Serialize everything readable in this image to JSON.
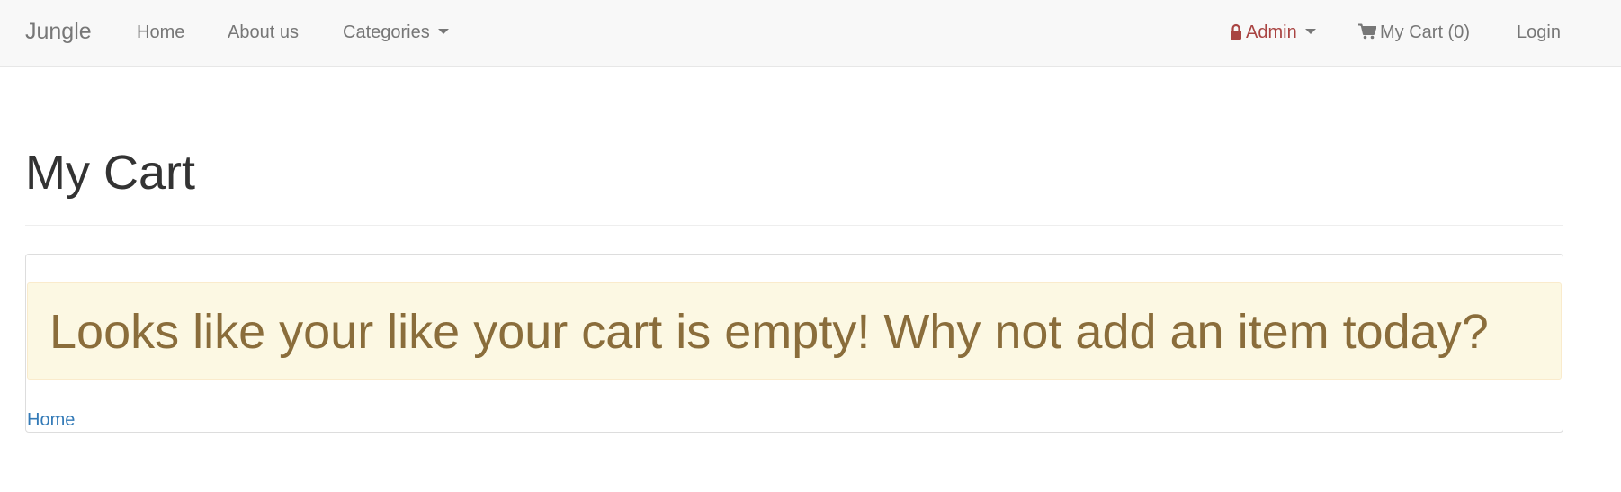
{
  "colors": {
    "navbar_bg": "#f8f8f8",
    "nav_text": "#777777",
    "admin_text": "#a94442",
    "title_text": "#333333",
    "alert_bg": "#fcf8e3",
    "alert_text": "#8a6d3b",
    "link": "#337ab7"
  },
  "navbar": {
    "brand": "Jungle",
    "left_items": [
      {
        "label": "Home"
      },
      {
        "label": "About us"
      },
      {
        "label": "Categories",
        "icon": "caret-down-icon"
      }
    ],
    "right_items": [
      {
        "label": "Admin",
        "icon": "lock-icon",
        "trailing_icon": "caret-down-icon"
      },
      {
        "label": "My Cart (0)",
        "icon": "shopping-cart-icon"
      },
      {
        "label": "Login"
      }
    ]
  },
  "main": {
    "title": "My Cart",
    "empty_message": "Looks like your like your cart is empty! Why not add an item today?",
    "home_link": "Home"
  }
}
